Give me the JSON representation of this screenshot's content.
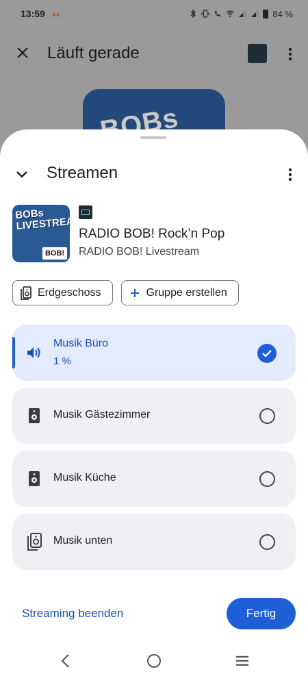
{
  "status_bar": {
    "time": "13:59",
    "battery_text": "84 %"
  },
  "background_app": {
    "title": "Läuft gerade",
    "art_text": "BOBs LIVESTREAM"
  },
  "sheet": {
    "title": "Streamen",
    "station": {
      "name": "RADIO BOB! Rock’n Pop",
      "subtitle": "RADIO BOB! Livestream",
      "art_title_line1": "BOBs",
      "art_title_line2": "LIVESTREAM",
      "art_logo": "BOB!"
    },
    "chips": [
      {
        "label": "Erdgeschoss",
        "icon": "speaker-group-icon"
      },
      {
        "label": "Gruppe erstellen",
        "icon": "plus-icon"
      }
    ],
    "devices": [
      {
        "name": "Musik Büro",
        "volume": "1 %",
        "selected": true,
        "icon": "volume-icon"
      },
      {
        "name": "Musik Gästezimmer",
        "selected": false,
        "icon": "speaker-icon"
      },
      {
        "name": "Musik Küche",
        "selected": false,
        "icon": "speaker-icon"
      },
      {
        "name": "Musik unten",
        "selected": false,
        "icon": "speaker-group-icon"
      }
    ],
    "stop_label": "Streaming beenden",
    "done_label": "Fertig"
  },
  "colors": {
    "accent": "#1f5fd6",
    "selected_bg": "#e3ebfc",
    "item_bg": "#eef0f3"
  }
}
